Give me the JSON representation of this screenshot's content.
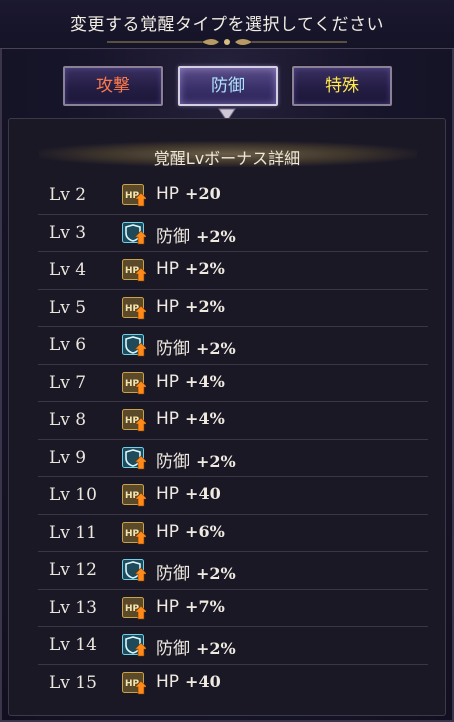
{
  "header": {
    "title": "変更する覚醒タイプを選択してください"
  },
  "tabs": [
    {
      "label": "攻撃",
      "color": "#ff7a4a",
      "selected": false
    },
    {
      "label": "防御",
      "color": "#aee3ff",
      "selected": true
    },
    {
      "label": "特殊",
      "color": "#ffe84a",
      "selected": false
    }
  ],
  "panel": {
    "title": "覚醒Lvボーナス詳細"
  },
  "rows": [
    {
      "level": "Lv 2",
      "icon": "hp-up-icon",
      "stat": "HP",
      "value": "+20"
    },
    {
      "level": "Lv 3",
      "icon": "defense-up-icon",
      "stat": "防御",
      "value": "+2%"
    },
    {
      "level": "Lv 4",
      "icon": "hp-up-icon",
      "stat": "HP",
      "value": "+2%"
    },
    {
      "level": "Lv 5",
      "icon": "hp-up-icon",
      "stat": "HP",
      "value": "+2%"
    },
    {
      "level": "Lv 6",
      "icon": "defense-up-icon",
      "stat": "防御",
      "value": "+2%"
    },
    {
      "level": "Lv 7",
      "icon": "hp-up-icon",
      "stat": "HP",
      "value": "+4%"
    },
    {
      "level": "Lv 8",
      "icon": "hp-up-icon",
      "stat": "HP",
      "value": "+4%"
    },
    {
      "level": "Lv 9",
      "icon": "defense-up-icon",
      "stat": "防御",
      "value": "+2%"
    },
    {
      "level": "Lv 10",
      "icon": "hp-up-icon",
      "stat": "HP",
      "value": "+40"
    },
    {
      "level": "Lv 11",
      "icon": "hp-up-icon",
      "stat": "HP",
      "value": "+6%"
    },
    {
      "level": "Lv 12",
      "icon": "defense-up-icon",
      "stat": "防御",
      "value": "+2%"
    },
    {
      "level": "Lv 13",
      "icon": "hp-up-icon",
      "stat": "HP",
      "value": "+7%"
    },
    {
      "level": "Lv 14",
      "icon": "defense-up-icon",
      "stat": "防御",
      "value": "+2%"
    },
    {
      "level": "Lv 15",
      "icon": "hp-up-icon",
      "stat": "HP",
      "value": "+40"
    }
  ]
}
